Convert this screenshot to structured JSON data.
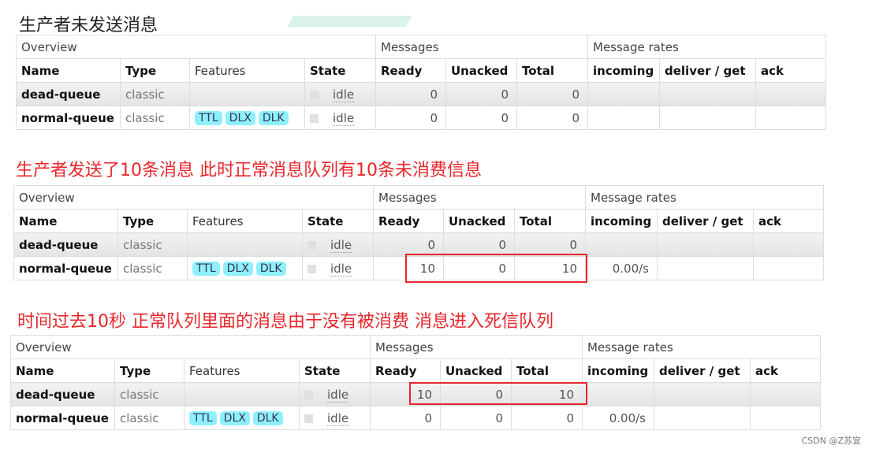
{
  "titles": [
    "生产者未发送消息",
    "生产者发送了10条消息 此时正常消息队列有10条未消费信息",
    "时间过去10秒  正常队列里面的消息由于没有被消费 消息进入死信队列"
  ],
  "group_headers": [
    "Overview",
    "Messages",
    "Message rates"
  ],
  "column_headers": [
    "Name",
    "Type",
    "Features",
    "State",
    "Ready",
    "Unacked",
    "Total",
    "incoming",
    "deliver / get",
    "ack"
  ],
  "tables": [
    {
      "rows": [
        {
          "name": "dead-queue",
          "type": "classic",
          "features": [],
          "state": "idle",
          "ready": "0",
          "unacked": "0",
          "total": "0",
          "incoming": "",
          "deliver_get": "",
          "ack": ""
        },
        {
          "name": "normal-queue",
          "type": "classic",
          "features": [
            "TTL",
            "DLX",
            "DLK"
          ],
          "state": "idle",
          "ready": "0",
          "unacked": "0",
          "total": "0",
          "incoming": "",
          "deliver_get": "",
          "ack": ""
        }
      ]
    },
    {
      "rows": [
        {
          "name": "dead-queue",
          "type": "classic",
          "features": [],
          "state": "idle",
          "ready": "0",
          "unacked": "0",
          "total": "0",
          "incoming": "",
          "deliver_get": "",
          "ack": ""
        },
        {
          "name": "normal-queue",
          "type": "classic",
          "features": [
            "TTL",
            "DLX",
            "DLK"
          ],
          "state": "idle",
          "ready": "10",
          "unacked": "0",
          "total": "10",
          "incoming": "0.00/s",
          "deliver_get": "",
          "ack": ""
        }
      ]
    },
    {
      "rows": [
        {
          "name": "dead-queue",
          "type": "classic",
          "features": [],
          "state": "idle",
          "ready": "10",
          "unacked": "0",
          "total": "10",
          "incoming": "",
          "deliver_get": "",
          "ack": ""
        },
        {
          "name": "normal-queue",
          "type": "classic",
          "features": [
            "TTL",
            "DLX",
            "DLK"
          ],
          "state": "idle",
          "ready": "0",
          "unacked": "0",
          "total": "0",
          "incoming": "0.00/s",
          "deliver_get": "",
          "ack": ""
        }
      ]
    }
  ],
  "credit": "CSDN @Z苏宜",
  "colors": {
    "highlight": "#e8262b",
    "feature_badge": "#8ef0fb"
  }
}
